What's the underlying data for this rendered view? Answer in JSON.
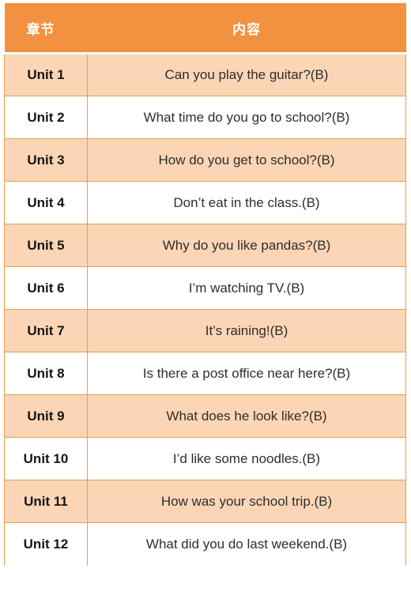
{
  "table": {
    "columns": [
      {
        "key": "chapter",
        "label": "章节"
      },
      {
        "key": "content",
        "label": "内容"
      }
    ],
    "rows": [
      {
        "chapter": "Unit 1",
        "content": "Can you play the guitar?(B)"
      },
      {
        "chapter": "Unit 2",
        "content": "What time do you go to school?(B)"
      },
      {
        "chapter": "Unit 3",
        "content": "How do you get to school?(B)"
      },
      {
        "chapter": "Unit 4",
        "content": "Don’t eat in the class.(B)"
      },
      {
        "chapter": "Unit 5",
        "content": "Why do you like pandas?(B)"
      },
      {
        "chapter": "Unit 6",
        "content": "I’m watching TV.(B)"
      },
      {
        "chapter": "Unit 7",
        "content": "It’s raining!(B)"
      },
      {
        "chapter": "Unit 8",
        "content": "Is there a post office near here?(B)"
      },
      {
        "chapter": "Unit 9",
        "content": "What does he look like?(B)"
      },
      {
        "chapter": "Unit 10",
        "content": "I’d like some noodles.(B)"
      },
      {
        "chapter": "Unit 11",
        "content": "How was your school trip.(B)"
      },
      {
        "chapter": "Unit 12",
        "content": "What did you do last weekend.(B)"
      }
    ]
  },
  "colors": {
    "header_background": "#F2913F",
    "header_text": "#FFFFFF",
    "row_stripe": "#FBD5B5",
    "row_plain": "#FFFFFF",
    "grid_line": "#ED9B4F",
    "chapter_text": "#161616",
    "content_text": "#2E2E2E"
  }
}
